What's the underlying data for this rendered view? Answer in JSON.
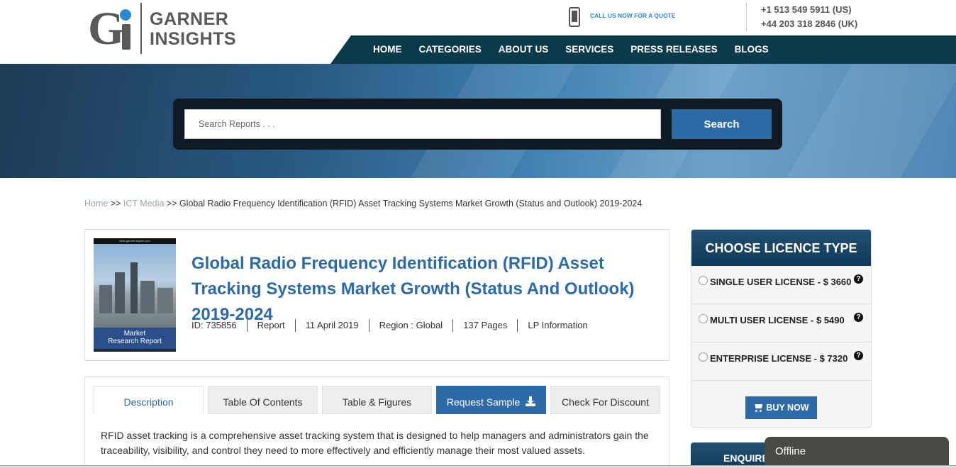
{
  "header": {
    "logo": {
      "mark": "Gi",
      "line1": "GARNER",
      "line2": "INSIGHTS"
    },
    "call_text": "CALL US NOW FOR A QUOTE",
    "phone_us": "+1   513 549 5911 (US)",
    "phone_uk": "+44 203 318 2846 (UK)",
    "nav": [
      "HOME",
      "CATEGORIES",
      "ABOUT US",
      "SERVICES",
      "PRESS RELEASES",
      "BLOGS"
    ]
  },
  "search": {
    "placeholder": "Search Reports . . .",
    "button_label": "Search"
  },
  "breadcrumb": {
    "home": "Home",
    "sep": ">>",
    "category": "ICT Media",
    "current": "Global Radio Frequency Identification (RFID) Asset Tracking Systems Market Growth (Status and Outlook) 2019-2024"
  },
  "report": {
    "cover_url": "www.garnerinsights.com",
    "cover_label_1": "Market",
    "cover_label_2": "Research Report",
    "title": "Global Radio Frequency Identification (RFID) Asset Tracking Systems Market Growth (Status And Outlook) 2019-2024",
    "meta": [
      "ID: 735856",
      "Report",
      "11 April 2019",
      "Region : Global",
      "137 Pages",
      "LP Information"
    ]
  },
  "tabs": {
    "description": "Description",
    "toc": "Table Of Contents",
    "figures": "Table & Figures",
    "sample": "Request Sample",
    "discount": "Check For Discount"
  },
  "description_text": "RFID asset tracking is a comprehensive asset tracking system that is designed to help managers and administrators gain the traceability, visibility, and control they need to more effectively and efficiently manage their most valued assets.",
  "licence": {
    "heading": "CHOOSE LICENCE TYPE",
    "options": [
      {
        "label": "SINGLE USER LICENSE - $ 3660"
      },
      {
        "label": "MULTI USER LICENSE - $ 5490"
      },
      {
        "label": "ENTERPRISE LICENSE - $ 7320"
      }
    ],
    "help_glyph": "?",
    "buy_label": "BUY NOW"
  },
  "enquire_label": "ENQUIRE",
  "chat_status": "Offline",
  "colors": {
    "accent": "#2e6aa6",
    "nav_bg": "#0d3a4b",
    "logo_dot": "#2a8ad0"
  }
}
